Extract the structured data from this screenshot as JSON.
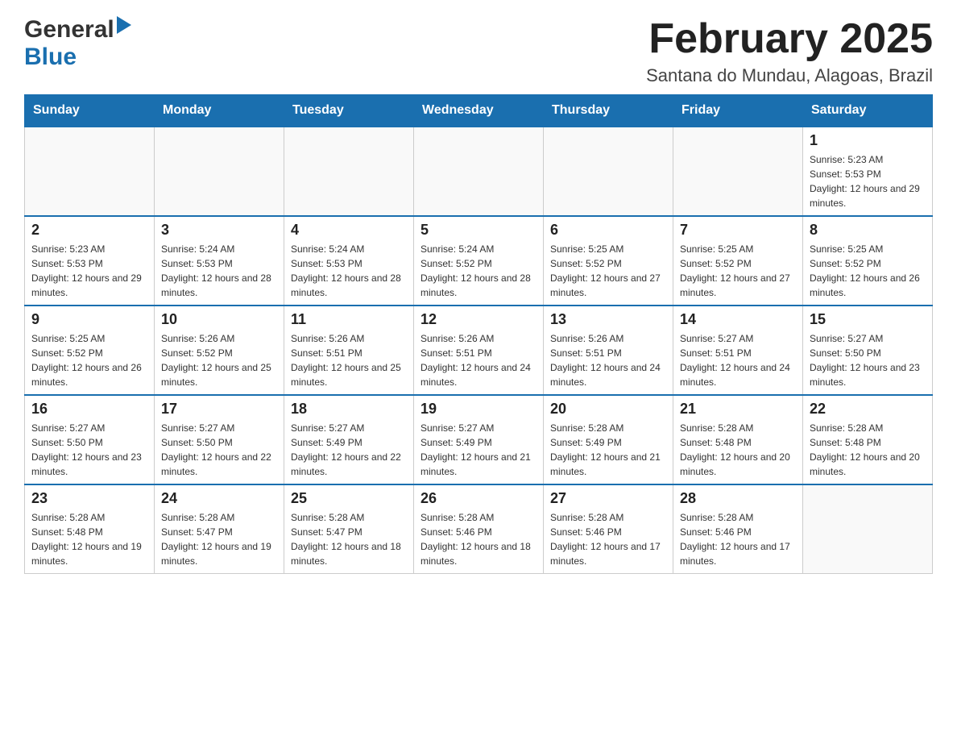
{
  "header": {
    "logo_general": "General",
    "logo_blue": "Blue",
    "month_title": "February 2025",
    "location": "Santana do Mundau, Alagoas, Brazil"
  },
  "weekdays": [
    "Sunday",
    "Monday",
    "Tuesday",
    "Wednesday",
    "Thursday",
    "Friday",
    "Saturday"
  ],
  "weeks": [
    [
      {
        "day": "",
        "sunrise": "",
        "sunset": "",
        "daylight": ""
      },
      {
        "day": "",
        "sunrise": "",
        "sunset": "",
        "daylight": ""
      },
      {
        "day": "",
        "sunrise": "",
        "sunset": "",
        "daylight": ""
      },
      {
        "day": "",
        "sunrise": "",
        "sunset": "",
        "daylight": ""
      },
      {
        "day": "",
        "sunrise": "",
        "sunset": "",
        "daylight": ""
      },
      {
        "day": "",
        "sunrise": "",
        "sunset": "",
        "daylight": ""
      },
      {
        "day": "1",
        "sunrise": "Sunrise: 5:23 AM",
        "sunset": "Sunset: 5:53 PM",
        "daylight": "Daylight: 12 hours and 29 minutes."
      }
    ],
    [
      {
        "day": "2",
        "sunrise": "Sunrise: 5:23 AM",
        "sunset": "Sunset: 5:53 PM",
        "daylight": "Daylight: 12 hours and 29 minutes."
      },
      {
        "day": "3",
        "sunrise": "Sunrise: 5:24 AM",
        "sunset": "Sunset: 5:53 PM",
        "daylight": "Daylight: 12 hours and 28 minutes."
      },
      {
        "day": "4",
        "sunrise": "Sunrise: 5:24 AM",
        "sunset": "Sunset: 5:53 PM",
        "daylight": "Daylight: 12 hours and 28 minutes."
      },
      {
        "day": "5",
        "sunrise": "Sunrise: 5:24 AM",
        "sunset": "Sunset: 5:52 PM",
        "daylight": "Daylight: 12 hours and 28 minutes."
      },
      {
        "day": "6",
        "sunrise": "Sunrise: 5:25 AM",
        "sunset": "Sunset: 5:52 PM",
        "daylight": "Daylight: 12 hours and 27 minutes."
      },
      {
        "day": "7",
        "sunrise": "Sunrise: 5:25 AM",
        "sunset": "Sunset: 5:52 PM",
        "daylight": "Daylight: 12 hours and 27 minutes."
      },
      {
        "day": "8",
        "sunrise": "Sunrise: 5:25 AM",
        "sunset": "Sunset: 5:52 PM",
        "daylight": "Daylight: 12 hours and 26 minutes."
      }
    ],
    [
      {
        "day": "9",
        "sunrise": "Sunrise: 5:25 AM",
        "sunset": "Sunset: 5:52 PM",
        "daylight": "Daylight: 12 hours and 26 minutes."
      },
      {
        "day": "10",
        "sunrise": "Sunrise: 5:26 AM",
        "sunset": "Sunset: 5:52 PM",
        "daylight": "Daylight: 12 hours and 25 minutes."
      },
      {
        "day": "11",
        "sunrise": "Sunrise: 5:26 AM",
        "sunset": "Sunset: 5:51 PM",
        "daylight": "Daylight: 12 hours and 25 minutes."
      },
      {
        "day": "12",
        "sunrise": "Sunrise: 5:26 AM",
        "sunset": "Sunset: 5:51 PM",
        "daylight": "Daylight: 12 hours and 24 minutes."
      },
      {
        "day": "13",
        "sunrise": "Sunrise: 5:26 AM",
        "sunset": "Sunset: 5:51 PM",
        "daylight": "Daylight: 12 hours and 24 minutes."
      },
      {
        "day": "14",
        "sunrise": "Sunrise: 5:27 AM",
        "sunset": "Sunset: 5:51 PM",
        "daylight": "Daylight: 12 hours and 24 minutes."
      },
      {
        "day": "15",
        "sunrise": "Sunrise: 5:27 AM",
        "sunset": "Sunset: 5:50 PM",
        "daylight": "Daylight: 12 hours and 23 minutes."
      }
    ],
    [
      {
        "day": "16",
        "sunrise": "Sunrise: 5:27 AM",
        "sunset": "Sunset: 5:50 PM",
        "daylight": "Daylight: 12 hours and 23 minutes."
      },
      {
        "day": "17",
        "sunrise": "Sunrise: 5:27 AM",
        "sunset": "Sunset: 5:50 PM",
        "daylight": "Daylight: 12 hours and 22 minutes."
      },
      {
        "day": "18",
        "sunrise": "Sunrise: 5:27 AM",
        "sunset": "Sunset: 5:49 PM",
        "daylight": "Daylight: 12 hours and 22 minutes."
      },
      {
        "day": "19",
        "sunrise": "Sunrise: 5:27 AM",
        "sunset": "Sunset: 5:49 PM",
        "daylight": "Daylight: 12 hours and 21 minutes."
      },
      {
        "day": "20",
        "sunrise": "Sunrise: 5:28 AM",
        "sunset": "Sunset: 5:49 PM",
        "daylight": "Daylight: 12 hours and 21 minutes."
      },
      {
        "day": "21",
        "sunrise": "Sunrise: 5:28 AM",
        "sunset": "Sunset: 5:48 PM",
        "daylight": "Daylight: 12 hours and 20 minutes."
      },
      {
        "day": "22",
        "sunrise": "Sunrise: 5:28 AM",
        "sunset": "Sunset: 5:48 PM",
        "daylight": "Daylight: 12 hours and 20 minutes."
      }
    ],
    [
      {
        "day": "23",
        "sunrise": "Sunrise: 5:28 AM",
        "sunset": "Sunset: 5:48 PM",
        "daylight": "Daylight: 12 hours and 19 minutes."
      },
      {
        "day": "24",
        "sunrise": "Sunrise: 5:28 AM",
        "sunset": "Sunset: 5:47 PM",
        "daylight": "Daylight: 12 hours and 19 minutes."
      },
      {
        "day": "25",
        "sunrise": "Sunrise: 5:28 AM",
        "sunset": "Sunset: 5:47 PM",
        "daylight": "Daylight: 12 hours and 18 minutes."
      },
      {
        "day": "26",
        "sunrise": "Sunrise: 5:28 AM",
        "sunset": "Sunset: 5:46 PM",
        "daylight": "Daylight: 12 hours and 18 minutes."
      },
      {
        "day": "27",
        "sunrise": "Sunrise: 5:28 AM",
        "sunset": "Sunset: 5:46 PM",
        "daylight": "Daylight: 12 hours and 17 minutes."
      },
      {
        "day": "28",
        "sunrise": "Sunrise: 5:28 AM",
        "sunset": "Sunset: 5:46 PM",
        "daylight": "Daylight: 12 hours and 17 minutes."
      },
      {
        "day": "",
        "sunrise": "",
        "sunset": "",
        "daylight": ""
      }
    ]
  ]
}
